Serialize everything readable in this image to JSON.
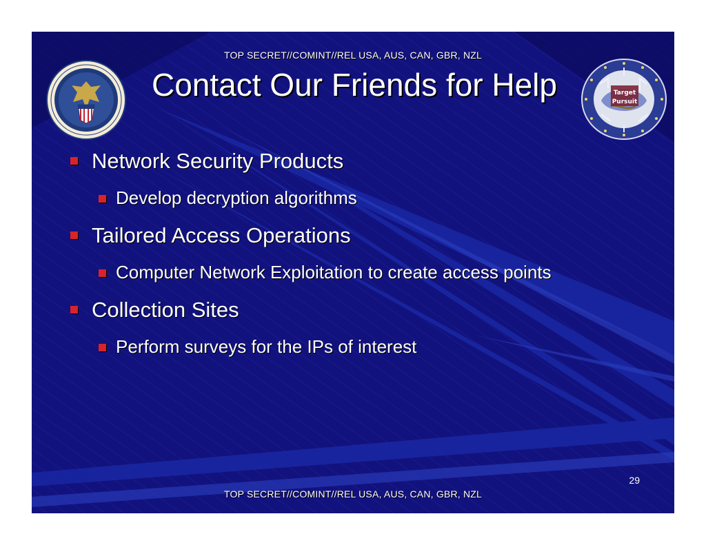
{
  "classification_top": "TOP SECRET//COMINT//REL USA, AUS, CAN, GBR, NZL",
  "classification_bottom": "TOP SECRET//COMINT//REL USA, AUS, CAN, GBR, NZL",
  "title": "Contact Our Friends for Help",
  "seals": {
    "left": {
      "text_top": "NATIONAL SECURITY AGENCY",
      "text_bottom": "UNITED STATES OF AMERICA"
    },
    "right": {
      "line1": "Target",
      "line2": "Pursuit"
    }
  },
  "bullets": [
    {
      "text": "Network Security Products",
      "sub": "Develop decryption algorithms"
    },
    {
      "text": "Tailored Access Operations",
      "sub": "Computer Network Exploitation to create access points"
    },
    {
      "text": "Collection Sites",
      "sub": "Perform surveys for the IPs of interest"
    }
  ],
  "page_number": "29",
  "colors": {
    "background": "#12127e",
    "bullet": "#d8232a",
    "text": "#ffffff"
  }
}
